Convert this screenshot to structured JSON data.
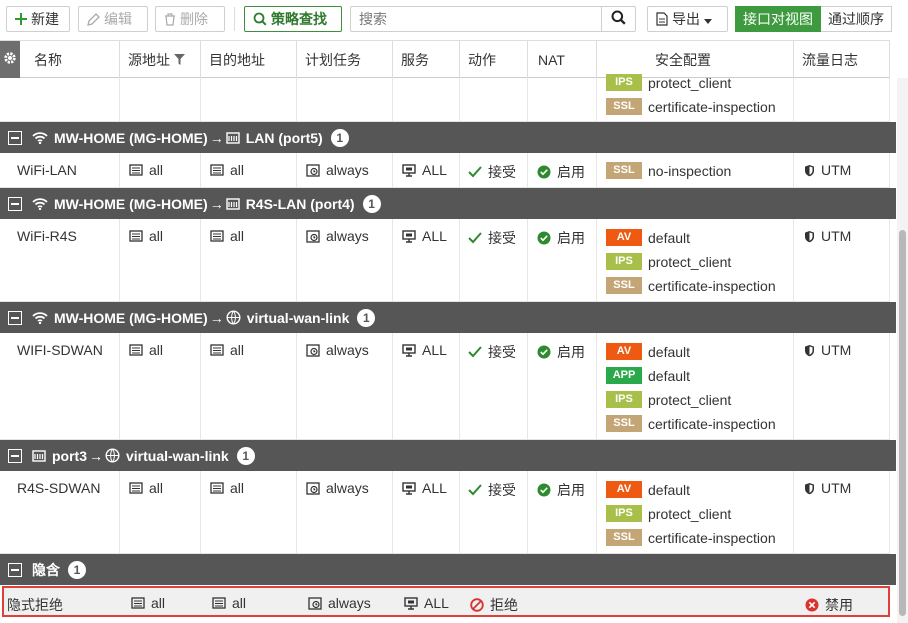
{
  "toolbar": {
    "new_label": "新建",
    "edit_label": "编辑",
    "delete_label": "删除",
    "policy_lookup_label": "策略查找",
    "search_placeholder": "搜索",
    "export_label": "导出",
    "view_interface_pair": "接口对视图",
    "view_sequence": "通过顺序"
  },
  "columns": [
    "名称",
    "源地址",
    "目的地址",
    "计划任务",
    "服务",
    "动作",
    "NAT",
    "安全配置",
    "流量日志"
  ],
  "top_partial": {
    "security": [
      {
        "badge": "IPS",
        "profile": "protect_client"
      },
      {
        "badge": "SSL",
        "profile": "certificate-inspection"
      }
    ]
  },
  "groups": [
    {
      "src": "MW-HOME (MG-HOME)",
      "arrow": "→",
      "dst": "LAN (port5)",
      "count": "1",
      "src_icon": "wifi-icon",
      "dst_icon": "interface-icon",
      "policy": {
        "name": "WiFi-LAN",
        "srcaddr": "all",
        "dstaddr": "all",
        "schedule": "always",
        "service": "ALL",
        "action": "接受",
        "nat": "启用",
        "log": "UTM",
        "security": [
          {
            "badge": "SSL",
            "profile": "no-inspection"
          }
        ]
      }
    },
    {
      "src": "MW-HOME (MG-HOME)",
      "arrow": "→",
      "dst": "R4S-LAN (port4)",
      "count": "1",
      "src_icon": "wifi-icon",
      "dst_icon": "interface-icon",
      "policy": {
        "name": "WiFi-R4S",
        "srcaddr": "all",
        "dstaddr": "all",
        "schedule": "always",
        "service": "ALL",
        "action": "接受",
        "nat": "启用",
        "log": "UTM",
        "security": [
          {
            "badge": "AV",
            "profile": "default"
          },
          {
            "badge": "IPS",
            "profile": "protect_client"
          },
          {
            "badge": "SSL",
            "profile": "certificate-inspection"
          }
        ]
      }
    },
    {
      "src": "MW-HOME (MG-HOME)",
      "arrow": "→",
      "dst": "virtual-wan-link",
      "count": "1",
      "src_icon": "wifi-icon",
      "dst_icon": "sdwan-globe-icon",
      "policy": {
        "name": "WIFI-SDWAN",
        "srcaddr": "all",
        "dstaddr": "all",
        "schedule": "always",
        "service": "ALL",
        "action": "接受",
        "nat": "启用",
        "log": "UTM",
        "security": [
          {
            "badge": "AV",
            "profile": "default"
          },
          {
            "badge": "APP",
            "profile": "default"
          },
          {
            "badge": "IPS",
            "profile": "protect_client"
          },
          {
            "badge": "SSL",
            "profile": "certificate-inspection"
          }
        ]
      }
    },
    {
      "src": "port3",
      "arrow": "→",
      "dst": "virtual-wan-link",
      "count": "1",
      "src_icon": "interface-icon",
      "dst_icon": "sdwan-globe-icon",
      "policy": {
        "name": "R4S-SDWAN",
        "srcaddr": "all",
        "dstaddr": "all",
        "schedule": "always",
        "service": "ALL",
        "action": "接受",
        "nat": "启用",
        "log": "UTM",
        "security": [
          {
            "badge": "AV",
            "profile": "default"
          },
          {
            "badge": "IPS",
            "profile": "protect_client"
          },
          {
            "badge": "SSL",
            "profile": "certificate-inspection"
          }
        ]
      }
    }
  ],
  "implicit": {
    "label": "隐含",
    "count": "1",
    "policy": {
      "name": "隐式拒绝",
      "srcaddr": "all",
      "dstaddr": "all",
      "schedule": "always",
      "service": "ALL",
      "action": "拒绝",
      "log": "禁用"
    }
  },
  "colors": {
    "group_header_bg": "#565656",
    "accent_green": "#3e9a3e",
    "badge_av": "#ef5a13",
    "badge_ips": "#a8c04a",
    "badge_ssl": "#c4a676",
    "badge_app": "#2aa84a",
    "deny_red": "#e0403c"
  }
}
